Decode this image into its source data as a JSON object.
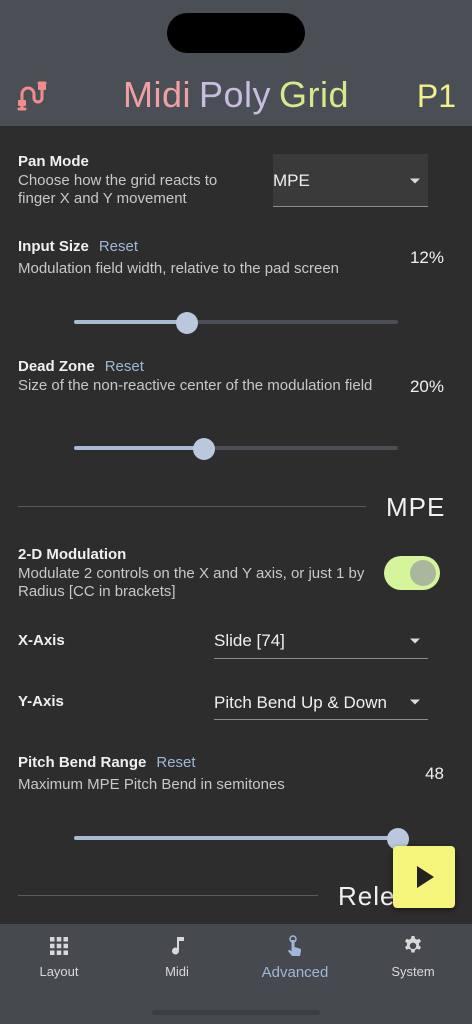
{
  "header": {
    "title_words": [
      {
        "text": "Midi",
        "color": "#f0a0a4"
      },
      {
        "text": "Poly",
        "color": "#c8bde0"
      },
      {
        "text": "Grid",
        "color": "#d5ea8c"
      }
    ],
    "preset": "P1",
    "logo_color": "#f08c8c"
  },
  "pan_mode": {
    "label": "Pan Mode",
    "description": "Choose how the grid reacts to finger X and Y movement",
    "value": "MPE"
  },
  "input_size": {
    "label": "Input Size",
    "reset": "Reset",
    "description": "Modulation field width, relative to the pad screen",
    "value_text": "12%",
    "fraction": 0.35
  },
  "dead_zone": {
    "label": "Dead Zone",
    "reset": "Reset",
    "description": "Size of the non-reactive center of the modulation field",
    "value_text": "20%",
    "fraction": 0.4
  },
  "mpe_section": {
    "title": "MPE"
  },
  "modulation_2d": {
    "label": "2-D Modulation",
    "description": "Modulate 2 controls on the X and Y axis, or just 1 by Radius [CC in brackets]",
    "enabled": true
  },
  "x_axis": {
    "label": "X-Axis",
    "value": "Slide [74]"
  },
  "y_axis": {
    "label": "Y-Axis",
    "value": "Pitch Bend Up & Down"
  },
  "pitch_bend": {
    "label": "Pitch Bend Range",
    "reset": "Reset",
    "description": "Maximum MPE Pitch Bend in semitones",
    "value_text": "48",
    "fraction": 1.0
  },
  "release_section": {
    "title": "Rele"
  },
  "nav": [
    {
      "label": "Layout",
      "icon": "grid-icon",
      "active": false
    },
    {
      "label": "Midi",
      "icon": "music-note-icon",
      "active": false
    },
    {
      "label": "Advanced",
      "icon": "touch-hand-icon",
      "active": true
    },
    {
      "label": "System",
      "icon": "gear-icon",
      "active": false
    }
  ],
  "colors": {
    "accent": "#9fb7d8",
    "toggle_on": "#d5f59d",
    "play_button": "#f4f57a"
  }
}
